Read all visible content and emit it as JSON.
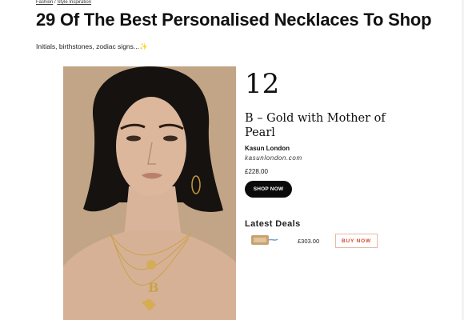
{
  "breadcrumb": {
    "section": "Fashion",
    "separator": "/",
    "subsection": "Style Inspiration"
  },
  "article": {
    "title": "29 Of The Best Personalised Necklaces To Shop",
    "subtitle": "Initials, birthstones, zodiac signs...✨"
  },
  "product": {
    "number": "12",
    "name": "B – Gold with Mother of Pearl",
    "brand": "Kasun London",
    "site": "kasunlondon.com",
    "price": "£228.00",
    "shop_label": "SHOP NOW"
  },
  "deals": {
    "heading": "Latest Deals",
    "items": [
      {
        "price": "£303.00",
        "buy_label": "BUY NOW"
      }
    ]
  },
  "colors": {
    "accent": "#d44b2f",
    "button_dark": "#0b0b0b",
    "photo_bg": "#c4a889"
  }
}
